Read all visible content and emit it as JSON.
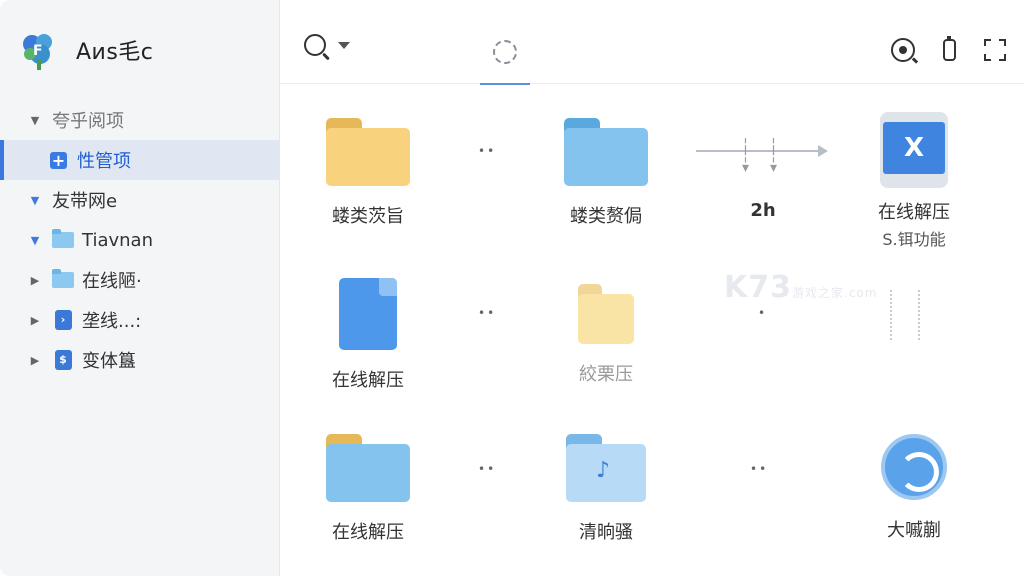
{
  "brand": {
    "title": "Aᴎs毛c"
  },
  "sidebar": {
    "items": [
      {
        "label": "夸乎阅项",
        "caret": "▼",
        "muted": true
      },
      {
        "label": "性管项",
        "active": true,
        "icon": "plus-icon"
      },
      {
        "label": "友带网e",
        "caret": "▼"
      },
      {
        "label": "Tiavnan",
        "caret": "▼",
        "icon": "folder-icon"
      },
      {
        "label": "在线陋·",
        "caret": "▶",
        "icon": "folder-icon"
      },
      {
        "label": "垄线...:",
        "caret": "▶",
        "icon": "doc-icon",
        "icon_glyph": "›"
      },
      {
        "label": "变体簋",
        "caret": "▶",
        "icon": "doc-icon",
        "icon_glyph": "$"
      }
    ]
  },
  "toolbar": {
    "icons": [
      "search-icon",
      "chevron-down-icon",
      "loading-icon",
      "target-icon",
      "phone-icon",
      "fullscreen-icon"
    ]
  },
  "grid": {
    "tiles": [
      {
        "label": "蝼类茨旨"
      },
      {
        "label": "蝼类赘侷"
      },
      {
        "label": "2h"
      },
      {
        "label": "在线解压",
        "sub": "S.铒功能",
        "glyph": "X"
      },
      {
        "label": "在线解压"
      },
      {
        "label": "絞栗压"
      },
      {
        "label": "在线解压"
      },
      {
        "label": "清晌骚"
      },
      {
        "label": "大嘁蒯"
      }
    ]
  },
  "watermark": {
    "text": "K73",
    "sub": "游戏之家",
    "domain": ".com"
  },
  "colors": {
    "accent": "#3a78e0",
    "folder_yellow": "#f8d27c",
    "folder_blue": "#84c3ee"
  }
}
